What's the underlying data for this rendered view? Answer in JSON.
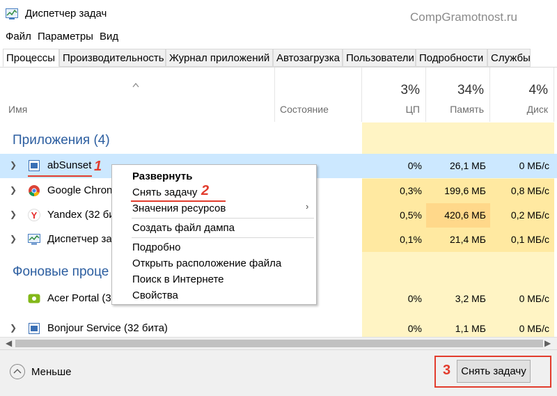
{
  "window": {
    "title": "Диспетчер задач",
    "watermark": "CompGramotnost.ru"
  },
  "menu": [
    "Файл",
    "Параметры",
    "Вид"
  ],
  "tabs": [
    "Процессы",
    "Производительность",
    "Журнал приложений",
    "Автозагрузка",
    "Пользователи",
    "Подробности",
    "Службы"
  ],
  "header": {
    "name": "Имя",
    "state": "Состояние",
    "cpu": {
      "pct": "3%",
      "label": "ЦП"
    },
    "mem": {
      "pct": "34%",
      "label": "Память"
    },
    "disk": {
      "pct": "4%",
      "label": "Диск"
    }
  },
  "groups": {
    "apps": "Приложения (4)",
    "background": "Фоновые проце"
  },
  "rows": [
    {
      "name": "abSunset",
      "cpu": "0%",
      "mem": "26,1 МБ",
      "disk": "0 МБ/с",
      "icon": "window-icon"
    },
    {
      "name": "Google Chron",
      "cpu": "0,3%",
      "mem": "199,6 МБ",
      "disk": "0,8 МБ/с",
      "icon": "chrome-icon"
    },
    {
      "name": "Yandex (32 би",
      "cpu": "0,5%",
      "mem": "420,6 МБ",
      "disk": "0,2 МБ/с",
      "icon": "yandex-icon"
    },
    {
      "name": "Диспетчер за",
      "cpu": "0,1%",
      "mem": "21,4 МБ",
      "disk": "0,1 МБ/с",
      "icon": "taskmgr-icon"
    },
    {
      "name": "Acer Portal (3",
      "cpu": "0%",
      "mem": "3,2 МБ",
      "disk": "0 МБ/с",
      "icon": "acer-icon"
    },
    {
      "name": "Bonjour Service (32 бита)",
      "cpu": "0%",
      "mem": "1,1 МБ",
      "disk": "0 МБ/с",
      "icon": "window-icon"
    }
  ],
  "context_menu": {
    "expand": "Развернуть",
    "end_task": "Снять задачу",
    "resource_values": "Значения ресурсов",
    "dump": "Создать файл дампа",
    "details": "Подробно",
    "open_location": "Открыть расположение файла",
    "search_web": "Поиск в Интернете",
    "properties": "Свойства"
  },
  "annotations": {
    "n1": "1",
    "n2": "2",
    "n3": "3"
  },
  "footer": {
    "less": "Меньше",
    "end_task": "Снять задачу"
  },
  "colors": {
    "heat_light": "#fff4c4",
    "heat_mid": "#ffe9a1",
    "heat_strong": "#ffd88a",
    "selected": "#cce8ff",
    "group_text": "#2c5ea0",
    "annotation_red": "#e23c2d"
  }
}
